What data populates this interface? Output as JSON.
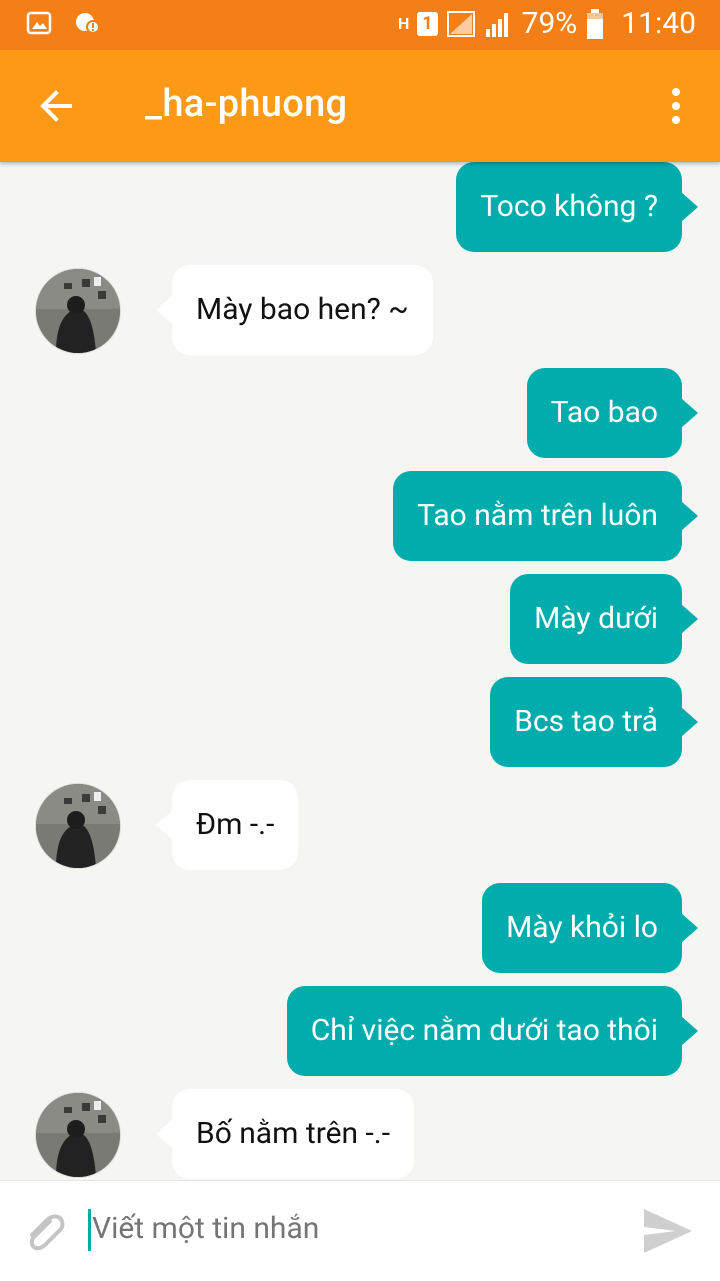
{
  "status_bar": {
    "network": "H",
    "sim": "1",
    "battery": "79%",
    "time": "11:40"
  },
  "header": {
    "title": "_ha-phuong"
  },
  "messages": [
    {
      "from": "me",
      "text": "Toco không ?"
    },
    {
      "from": "them",
      "text": "Mày bao hen? ~"
    },
    {
      "from": "me",
      "text": "Tao bao"
    },
    {
      "from": "me",
      "text": "Tao nằm trên luôn"
    },
    {
      "from": "me",
      "text": "Mày dưới"
    },
    {
      "from": "me",
      "text": "Bcs tao trả"
    },
    {
      "from": "them",
      "text": "Đm -.-"
    },
    {
      "from": "me",
      "text": "Mày khỏi lo"
    },
    {
      "from": "me",
      "text": "Chỉ việc nằm dưới tao thôi"
    },
    {
      "from": "them",
      "text": "Bố nằm trên -.-"
    }
  ],
  "composer": {
    "placeholder": "Viết một tin nhắn"
  },
  "colors": {
    "status_bar": "#f57f17",
    "app_bar": "#fc9a18",
    "my_bubble": "#00acac",
    "their_bubble": "#ffffff",
    "chat_background": "#f5f5f1"
  }
}
